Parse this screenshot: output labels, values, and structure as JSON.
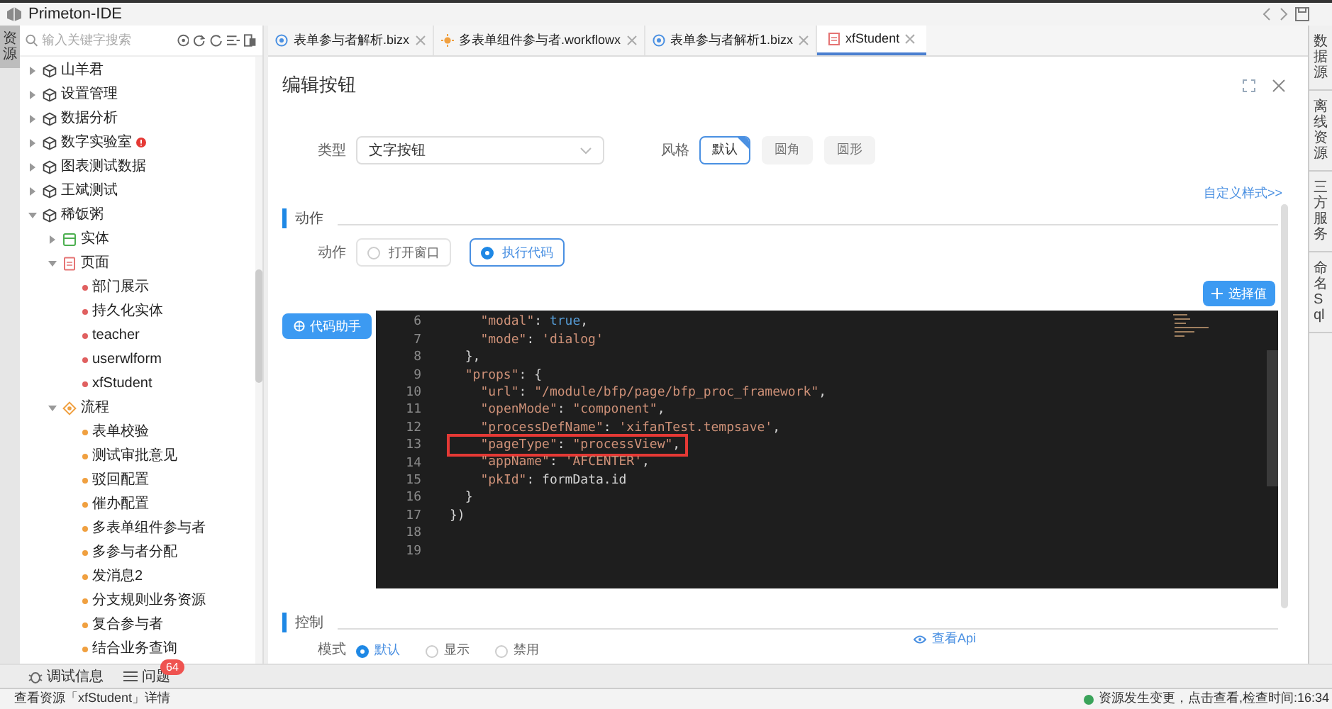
{
  "window": {
    "title": "Primeton-IDE"
  },
  "left_rail": [
    {
      "label": "资源",
      "selected": true
    }
  ],
  "sidebar": {
    "search": {
      "placeholder": "输入关键字搜索"
    },
    "tree": [
      {
        "label": "山羊君",
        "kind": "module",
        "expanded": false,
        "error": false
      },
      {
        "label": "设置管理",
        "kind": "module",
        "expanded": false,
        "error": false
      },
      {
        "label": "数据分析",
        "kind": "module",
        "expanded": false,
        "error": false
      },
      {
        "label": "数字实验室",
        "kind": "module",
        "expanded": false,
        "error": true
      },
      {
        "label": "图表测试数据",
        "kind": "module",
        "expanded": false,
        "error": false
      },
      {
        "label": "王斌测试",
        "kind": "module",
        "expanded": false,
        "error": false
      },
      {
        "label": "稀饭粥",
        "kind": "module",
        "expanded": true,
        "error": false,
        "children": [
          {
            "label": "实体",
            "kind": "entity",
            "expanded": false
          },
          {
            "label": "页面",
            "kind": "page",
            "expanded": true,
            "children": [
              {
                "label": "部门展示",
                "kind": "page_item"
              },
              {
                "label": "持久化实体",
                "kind": "page_item"
              },
              {
                "label": "teacher",
                "kind": "page_item"
              },
              {
                "label": "userwlform",
                "kind": "page_item"
              },
              {
                "label": "xfStudent",
                "kind": "page_item"
              }
            ]
          },
          {
            "label": "流程",
            "kind": "flow",
            "expanded": true,
            "children": [
              {
                "label": "表单校验",
                "kind": "flow_item"
              },
              {
                "label": "测试审批意见",
                "kind": "flow_item"
              },
              {
                "label": "驳回配置",
                "kind": "flow_item"
              },
              {
                "label": "催办配置",
                "kind": "flow_item"
              },
              {
                "label": "多表单组件参与者",
                "kind": "flow_item"
              },
              {
                "label": "多参与者分配",
                "kind": "flow_item"
              },
              {
                "label": "发消息2",
                "kind": "flow_item"
              },
              {
                "label": "分支规则业务资源",
                "kind": "flow_item"
              },
              {
                "label": "复合参与者",
                "kind": "flow_item"
              },
              {
                "label": "结合业务查询",
                "kind": "flow_item"
              }
            ]
          }
        ]
      }
    ]
  },
  "bottom_tabs": [
    {
      "label": "调试信息",
      "kind": "debug"
    },
    {
      "label": "问题",
      "kind": "problems",
      "badge": "64"
    }
  ],
  "tabs": [
    {
      "label": "表单参与者解析.bizx",
      "kind": "biz",
      "selected": false
    },
    {
      "label": "多表单组件参与者.workflowx",
      "kind": "flow",
      "selected": false
    },
    {
      "label": "表单参与者解析1.bizx",
      "kind": "biz",
      "selected": false
    },
    {
      "label": "xfStudent",
      "kind": "page",
      "selected": true
    }
  ],
  "dialog": {
    "title": "编辑按钮",
    "type_label": "类型",
    "type_value": "文字按钮",
    "style_label": "风格",
    "styles": [
      {
        "label": "默认",
        "selected": true
      },
      {
        "label": "圆角",
        "selected": false
      },
      {
        "label": "圆形",
        "selected": false
      }
    ],
    "custom_style_link": "自定义样式>>",
    "action_section": "动作",
    "action_label": "动作",
    "actions": [
      {
        "label": "打开窗口",
        "selected": false
      },
      {
        "label": "执行代码",
        "selected": true
      }
    ],
    "select_value_button": "选择值",
    "code_helper_button": "代码助手",
    "code": [
      {
        "number": "6",
        "text": "    \"modal\": true,",
        "highlighted": false
      },
      {
        "number": "7",
        "text": "    \"mode\": 'dialog'",
        "highlighted": false
      },
      {
        "number": "8",
        "text": "  },",
        "highlighted": false
      },
      {
        "number": "9",
        "text": "  \"props\": {",
        "highlighted": false
      },
      {
        "number": "10",
        "text": "    \"url\": \"/module/bfp/page/bfp_proc_framework\",",
        "highlighted": false
      },
      {
        "number": "11",
        "text": "    \"openMode\": \"component\",",
        "highlighted": false
      },
      {
        "number": "12",
        "text": "    \"processDefName\": 'xifanTest.tempsave',",
        "highlighted": false
      },
      {
        "number": "13",
        "text": "    \"pageType\": \"processView\",",
        "highlighted": true
      },
      {
        "number": "14",
        "text": "    \"appName\": 'AFCENTER',",
        "highlighted": false
      },
      {
        "number": "15",
        "text": "    \"pkId\": formData.id",
        "highlighted": false
      },
      {
        "number": "16",
        "text": "  }",
        "highlighted": false
      },
      {
        "number": "17",
        "text": "})",
        "highlighted": false
      },
      {
        "number": "18",
        "highlighted": false
      },
      {
        "number": "19",
        "highlighted": false
      }
    ],
    "control_section": "控制",
    "view_api_link": "查看Api",
    "mode_label": "模式",
    "modes": [
      {
        "label": "默认",
        "selected": true
      },
      {
        "label": "显示",
        "selected": false
      },
      {
        "label": "禁用",
        "selected": false
      }
    ]
  },
  "right_rail": [
    {
      "label": "数据源"
    },
    {
      "label": "离线资源"
    },
    {
      "label": "三方服务"
    },
    {
      "label": "命名Sql"
    }
  ],
  "status_bar": {
    "message": "查看资源「xfStudent」详情",
    "notice": "资源发生变更，点击查看,检查时间:16:34"
  }
}
